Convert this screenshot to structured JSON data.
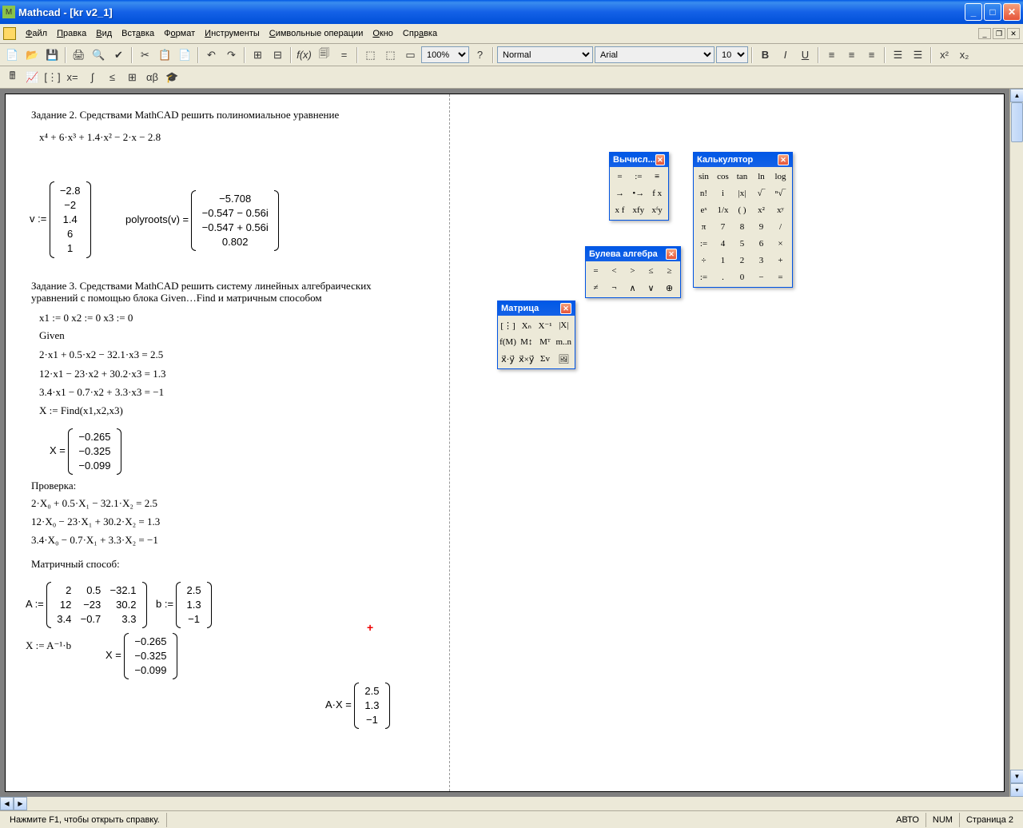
{
  "title": "Mathcad - [kr v2_1]",
  "menu": [
    "Файл",
    "Правка",
    "Вид",
    "Вставка",
    "Формат",
    "Инструменты",
    "Символьные операции",
    "Окно",
    "Справка"
  ],
  "zoom": "100%",
  "style": "Normal",
  "font": "Arial",
  "size": "10",
  "status_hint": "Нажмите F1, чтобы открыть справку.",
  "status_auto": "АВТО",
  "status_num": "NUM",
  "status_page": "Страница 2",
  "task2_title": "Задание 2. Средствами MathCAD решить полиномиальное уравнение",
  "task2_poly": "x⁴ + 6·x³ + 1.4·x² − 2·x − 2.8",
  "v_label": "v :=",
  "v_vals": [
    "−2.8",
    "−2",
    "1.4",
    "6",
    "1"
  ],
  "polyroots_label": "polyroots(v) =",
  "polyroots_vals": [
    "−5.708",
    "−0.547 − 0.56i",
    "−0.547 + 0.56i",
    "0.802"
  ],
  "task3_title1": "Задание 3. Средствами MathCAD решить систему линейных алгебраических",
  "task3_title2": "уравнений с помощью блока Given…Find и матричным способом",
  "init_vars": "x1 := 0        x2 := 0        x3 := 0",
  "given": "Given",
  "eq1": "2·x1 + 0.5·x2 − 32.1·x3 = 2.5",
  "eq2": "12·x1 − 23·x2 + 30.2·x3 = 1.3",
  "eq3": "3.4·x1 − 0.7·x2 + 3.3·x3 = −1",
  "find": "X := Find(x1,x2,x3)",
  "X_label": "X =",
  "X_vals": [
    "−0.265",
    "−0.325",
    "−0.099"
  ],
  "proverka": "Проверка:",
  "pv1": "2·X₀ + 0.5·X₁ − 32.1·X₂ = 2.5",
  "pv2": "12·X₀ − 23·X₁ + 30.2·X₂ = 1.3",
  "pv3": "3.4·X₀ − 0.7·X₁ + 3.3·X₂ = −1",
  "matrix_way": "Матричный способ:",
  "A_label": "A :=",
  "A_rows": [
    [
      "2",
      "0.5",
      "−32.1"
    ],
    [
      "12",
      "−23",
      "30.2"
    ],
    [
      "3.4",
      "−0.7",
      "3.3"
    ]
  ],
  "b_label": "b :=",
  "b_vals": [
    "2.5",
    "1.3",
    "−1"
  ],
  "X_assign": "X := A⁻¹·b",
  "X2_label": "X =",
  "X2_vals": [
    "−0.265",
    "−0.325",
    "−0.099"
  ],
  "AX_label": "A·X =",
  "AX_vals": [
    "2.5",
    "1.3",
    "−1"
  ],
  "palettes": {
    "eval": {
      "title": "Вычисл...",
      "cells": [
        "=",
        ":=",
        "≡",
        "→",
        "•→",
        "f x",
        "x f",
        "xfy",
        "xᶠy"
      ]
    },
    "bool": {
      "title": "Булева алгебра",
      "cells": [
        "=",
        "<",
        ">",
        "≤",
        "≥",
        "≠",
        "¬",
        "∧",
        "∨",
        "⊕"
      ]
    },
    "matrix": {
      "title": "Матрица",
      "cells": [
        "[⋮]",
        "Xₙ",
        "X⁻¹",
        "|X|",
        "f(M)",
        "M↕",
        "Mᵀ",
        "m..n",
        "x⃗·y⃗",
        "x⃗×y⃗",
        "Σv",
        "🖼"
      ]
    },
    "calc": {
      "title": "Калькулятор",
      "cells": [
        "sin",
        "cos",
        "tan",
        "ln",
        "log",
        "n!",
        "i",
        "|x|",
        "√‾",
        "ⁿ√‾",
        "eˣ",
        "1/x",
        "( )",
        "x²",
        "xʸ",
        "π",
        "7",
        "8",
        "9",
        "/",
        ":=",
        "4",
        "5",
        "6",
        "×",
        "÷",
        "1",
        "2",
        "3",
        "+",
        ":=",
        ".",
        "0",
        "−",
        "="
      ]
    }
  }
}
